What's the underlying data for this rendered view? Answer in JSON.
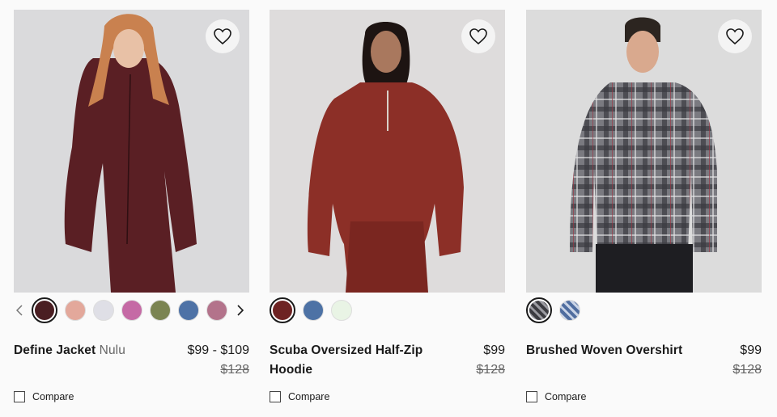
{
  "products": [
    {
      "title": "Define Jacket",
      "subtitle": "Nulu",
      "price": "$99 - $109",
      "old_price": "$128",
      "compare_label": "Compare",
      "swatches": [
        "#4a1e22",
        "#e3a89b",
        "#dfdfe6",
        "#c56aa5",
        "#7b8452",
        "#4e72a6",
        "#b3738b"
      ],
      "image_bg": "#dadadc",
      "garment": "#5a1f24"
    },
    {
      "title": "Scuba Oversized Half-Zip Hoodie",
      "subtitle": "",
      "price": "$99",
      "old_price": "$128",
      "compare_label": "Compare",
      "swatches": [
        "#6e2323",
        "#4d72a5",
        "#e9f4e5"
      ],
      "image_bg": "#dedcdc",
      "garment": "#8c2f27"
    },
    {
      "title": "Brushed Woven Overshirt",
      "subtitle": "",
      "price": "$99",
      "old_price": "$128",
      "compare_label": "Compare",
      "swatches": [
        "#4f4f55",
        "#7189b5"
      ],
      "image_bg": "#dcdcdc",
      "garment": "#6a6a70"
    }
  ]
}
